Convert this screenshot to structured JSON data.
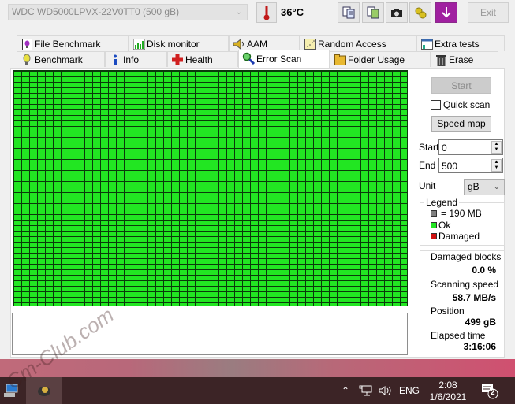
{
  "toolbar": {
    "drive": "WDC WD5000LPVX-22V0TT0 (500 gB)",
    "temperature": "36°C",
    "icons": [
      "copy-text-icon",
      "copy-image-icon",
      "camera-icon",
      "options-icon",
      "download-icon"
    ],
    "exit_label": "Exit"
  },
  "tabs": {
    "row1": [
      {
        "label": "File Benchmark",
        "icon": "file-benchmark-icon"
      },
      {
        "label": "Disk monitor",
        "icon": "disk-monitor-icon"
      },
      {
        "label": "AAM",
        "icon": "speaker-icon"
      },
      {
        "label": "Random Access",
        "icon": "random-access-icon"
      },
      {
        "label": "Extra tests",
        "icon": "extra-tests-icon"
      }
    ],
    "row2": [
      {
        "label": "Benchmark",
        "icon": "bulb-icon"
      },
      {
        "label": "Info",
        "icon": "info-icon"
      },
      {
        "label": "Health",
        "icon": "health-cross-icon"
      },
      {
        "label": "Error Scan",
        "icon": "magnifier-icon",
        "active": true
      },
      {
        "label": "Folder Usage",
        "icon": "folder-icon"
      },
      {
        "label": "Erase",
        "icon": "trash-icon"
      }
    ]
  },
  "scan": {
    "start_button": "Start",
    "quick_scan_label": "Quick scan",
    "quick_scan_checked": false,
    "speed_map_button": "Speed map",
    "start_label": "Start",
    "start_value": "0",
    "end_label": "End",
    "end_value": "500",
    "unit_label": "Unit",
    "unit_value": "gB",
    "block_status": "all ok",
    "colors": {
      "ok": "#22e622",
      "damaged": "#d01010",
      "block": "#808080"
    }
  },
  "legend": {
    "title": "Legend",
    "items": [
      {
        "label": "= 190 MB",
        "color": "#808080"
      },
      {
        "label": "Ok",
        "color": "#22e622"
      },
      {
        "label": "Damaged",
        "color": "#d01010"
      }
    ]
  },
  "stats": {
    "damaged_blocks_label": "Damaged blocks",
    "damaged_blocks_value": "0.0 %",
    "scanning_speed_label": "Scanning speed",
    "scanning_speed_value": "58.7 MB/s",
    "position_label": "Position",
    "position_value": "499 gB",
    "elapsed_label": "Elapsed time",
    "elapsed_value": "3:16:06"
  },
  "taskbar": {
    "apps": [
      "computer-app-icon",
      "hdtune-app-icon"
    ],
    "language": "ENG",
    "time": "2:08",
    "date": "1/6/2021",
    "notification_count": "2"
  },
  "watermark": "Cm-Club.com"
}
